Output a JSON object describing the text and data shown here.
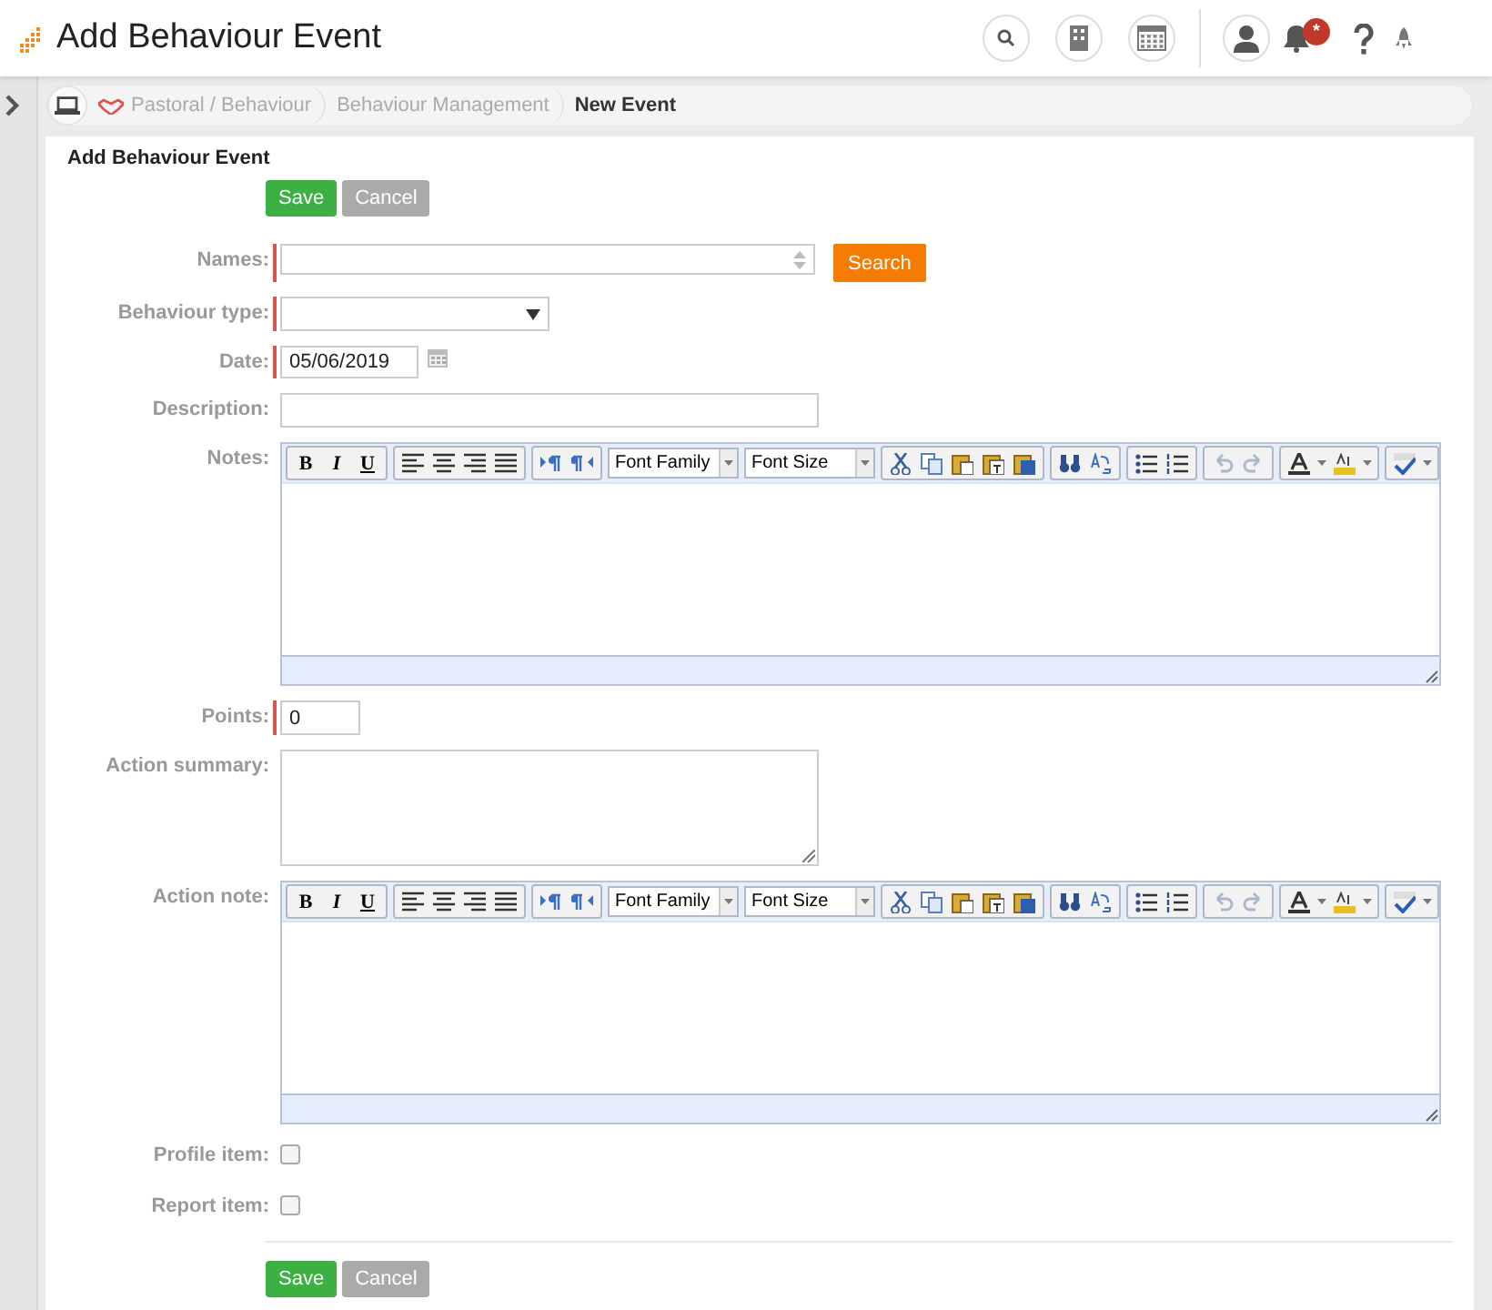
{
  "header": {
    "title": "Add Behaviour Event",
    "notification_badge": "*"
  },
  "breadcrumbs": [
    {
      "label": "Pastoral / Behaviour",
      "current": false
    },
    {
      "label": "Behaviour Management",
      "current": false
    },
    {
      "label": "New Event",
      "current": true
    }
  ],
  "form": {
    "heading": "Add Behaviour Event",
    "top_buttons": [
      {
        "label": "Save",
        "kind": "primary"
      },
      {
        "label": "Cancel",
        "kind": "secondary"
      }
    ],
    "fields": [
      {
        "kind": "lookup",
        "label": "Names:",
        "required": true,
        "button": "Search"
      },
      {
        "kind": "select",
        "label": "Behaviour type:",
        "required": true
      },
      {
        "kind": "date",
        "label": "Date:",
        "required": true,
        "value": "05/06/2019"
      },
      {
        "kind": "text",
        "label": "Description:",
        "required": false
      },
      {
        "kind": "editor",
        "label": "Notes:",
        "required": false,
        "format_buttons": [
          "B",
          "I",
          "U"
        ],
        "font_family": "Font Family",
        "font_size": "Font Size"
      },
      {
        "kind": "number",
        "label": "Points:",
        "required": true,
        "value": "0"
      },
      {
        "kind": "textarea",
        "label": "Action summary:",
        "required": false
      },
      {
        "kind": "editor",
        "label": "Action note:",
        "required": false,
        "format_buttons": [
          "B",
          "I",
          "U"
        ],
        "font_family": "Font Family",
        "font_size": "Font Size"
      },
      {
        "kind": "checkbox",
        "label": "Profile item:",
        "required": false,
        "checked": false
      },
      {
        "kind": "checkbox",
        "label": "Report item:",
        "required": false,
        "checked": false
      }
    ],
    "bottom_buttons": [
      {
        "label": "Save",
        "kind": "primary"
      },
      {
        "label": "Cancel",
        "kind": "secondary"
      }
    ]
  }
}
